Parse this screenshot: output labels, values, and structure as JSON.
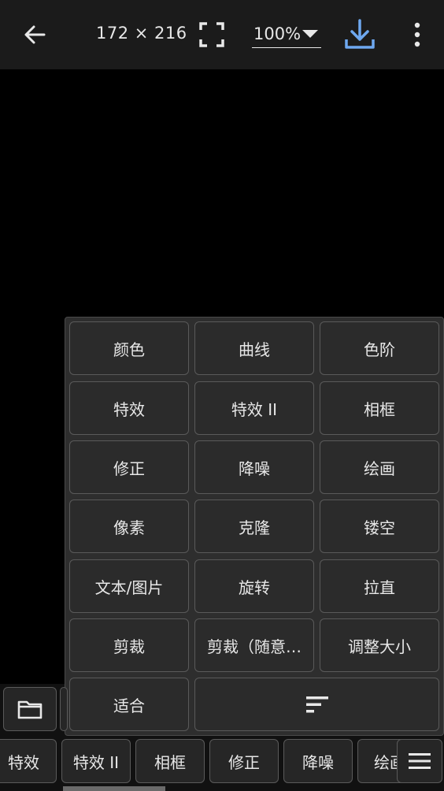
{
  "topbar": {
    "dimensions": "172 × 216",
    "zoom": "100%"
  },
  "menu": {
    "items": [
      "颜色",
      "曲线",
      "色阶",
      "特效",
      "特效 II",
      "相框",
      "修正",
      "降噪",
      "绘画",
      "像素",
      "克隆",
      "镂空",
      "文本/图片",
      "旋转",
      "拉直",
      "剪裁",
      "剪裁（随意…",
      "调整大小",
      "适合"
    ]
  },
  "tabs": [
    "特效",
    "特效 II",
    "相框",
    "修正",
    "降噪",
    "绘画"
  ],
  "icons": {
    "back": "arrow-left-icon",
    "fit": "fullscreen-icon",
    "download": "download-icon",
    "more": "more-vert-icon",
    "sort": "sort-icon",
    "folder": "folder-icon",
    "menu": "hamburger-icon"
  },
  "colors": {
    "accent": "#6ea8f0",
    "panel": "#2e2e2e",
    "border": "#5a5a5a"
  }
}
